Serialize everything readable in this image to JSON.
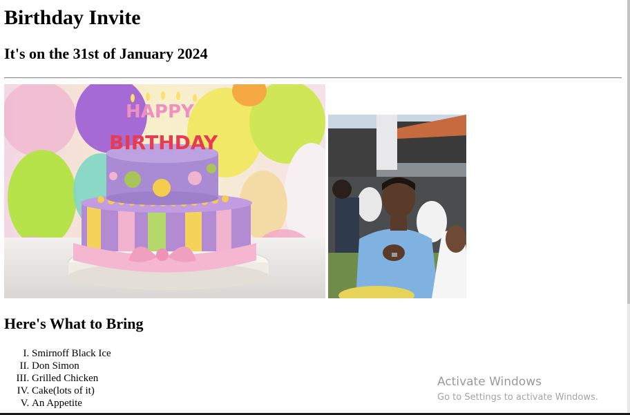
{
  "page": {
    "title": "Birthday Invite",
    "date_line": "It's on the 31st of January 2024",
    "bring_heading": "Here's What to Bring",
    "bring_items": [
      "Smirnoff Black Ice",
      "Don Simon",
      "Grilled Chicken",
      "Cake(lots of it)",
      "An Appetite"
    ]
  },
  "images": {
    "cake": {
      "topper_line1": "HAPPY",
      "topper_line2": "BIRTHDAY"
    },
    "party": {}
  },
  "watermark": {
    "title": "Activate Windows",
    "subtitle": "Go to Settings to activate Windows."
  }
}
